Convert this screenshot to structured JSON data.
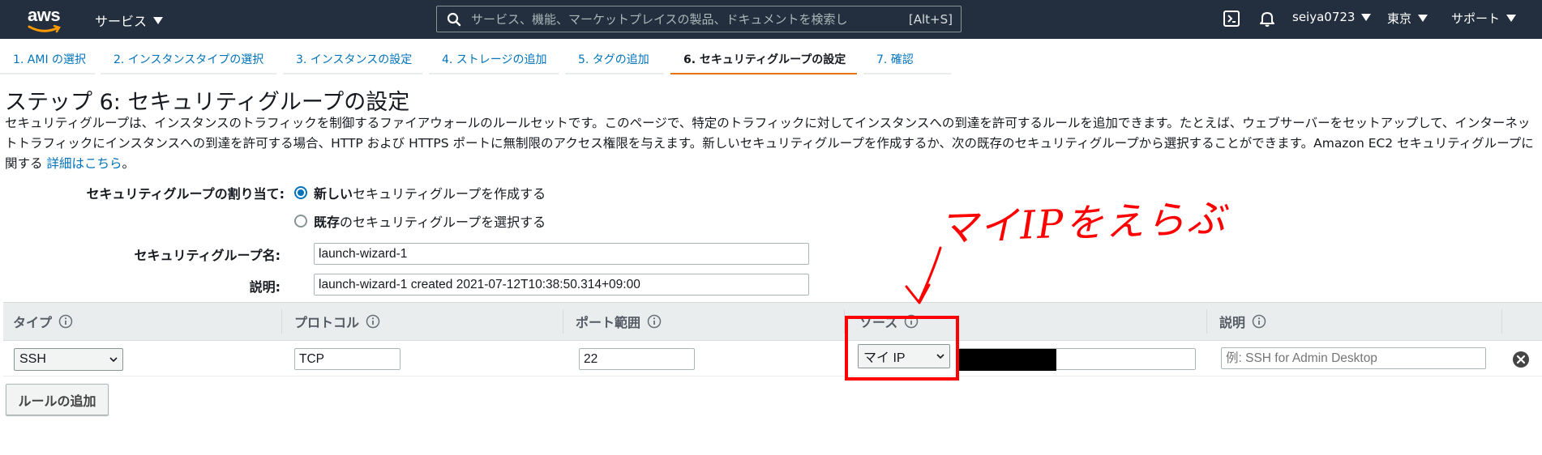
{
  "nav": {
    "logo_text": "aws",
    "services_label": "サービス",
    "search_placeholder": "サービス、機能、マーケットプレイスの製品、ドキュメントを検索し",
    "search_shortcut": "[Alt+S]",
    "user": "seiya0723",
    "region": "東京",
    "support": "サポート"
  },
  "tabs": [
    {
      "label": "1. AMI の選択",
      "active": false
    },
    {
      "label": "2. インスタンスタイプの選択",
      "active": false
    },
    {
      "label": "3. インスタンスの設定",
      "active": false
    },
    {
      "label": "4. ストレージの追加",
      "active": false
    },
    {
      "label": "5. タグの追加",
      "active": false
    },
    {
      "label": "6. セキュリティグループの設定",
      "active": true
    },
    {
      "label": "7. 確認",
      "active": false
    }
  ],
  "page": {
    "title": "ステップ 6: セキュリティグループの設定",
    "description_1": "セキュリティグループは、インスタンスのトラフィックを制御するファイアウォールのルールセットです。このページで、特定のトラフィックに対してインスタンスへの到達を許可するルールを追加できます。たとえば、ウェブサーバーをセットアップして、インターネットトラフィックにインスタンスへの到達を許可する場合、HTTP および HTTPS ポートに無制限のアクセス権限を与えます。新しいセキュリティグループを作成するか、次の既存のセキュリティグループから選択することができます。Amazon EC2 セキュリティグループに関する",
    "description_link": "詳細はこちら",
    "description_end": "。"
  },
  "form": {
    "assign_label": "セキュリティグループの割り当て:",
    "option_new_bold": "新しい",
    "option_new_rest": "セキュリティグループを作成する",
    "option_existing_bold": "既存",
    "option_existing_rest": "のセキュリティグループを選択する",
    "selected_option": "new",
    "name_label": "セキュリティグループ名:",
    "name_value": "launch-wizard-1",
    "desc_label": "説明:",
    "desc_value": "launch-wizard-1 created 2021-07-12T10:38:50.314+09:00"
  },
  "table": {
    "headers": {
      "type": "タイプ",
      "protocol": "プロトコル",
      "port": "ポート範囲",
      "source": "ソース",
      "description": "説明"
    },
    "rows": [
      {
        "type": "SSH",
        "protocol": "TCP",
        "port": "22",
        "source": "マイ IP",
        "description_placeholder": "例: SSH for Admin Desktop"
      }
    ]
  },
  "add_rule_label": "ルールの追加",
  "annotation": {
    "handwritten_note": "マイIPをえらぶ",
    "color": "#ff0000"
  },
  "colors": {
    "nav_bg": "#232f3e",
    "link": "#0073bb",
    "active_tab_underline": "#ec7211"
  }
}
